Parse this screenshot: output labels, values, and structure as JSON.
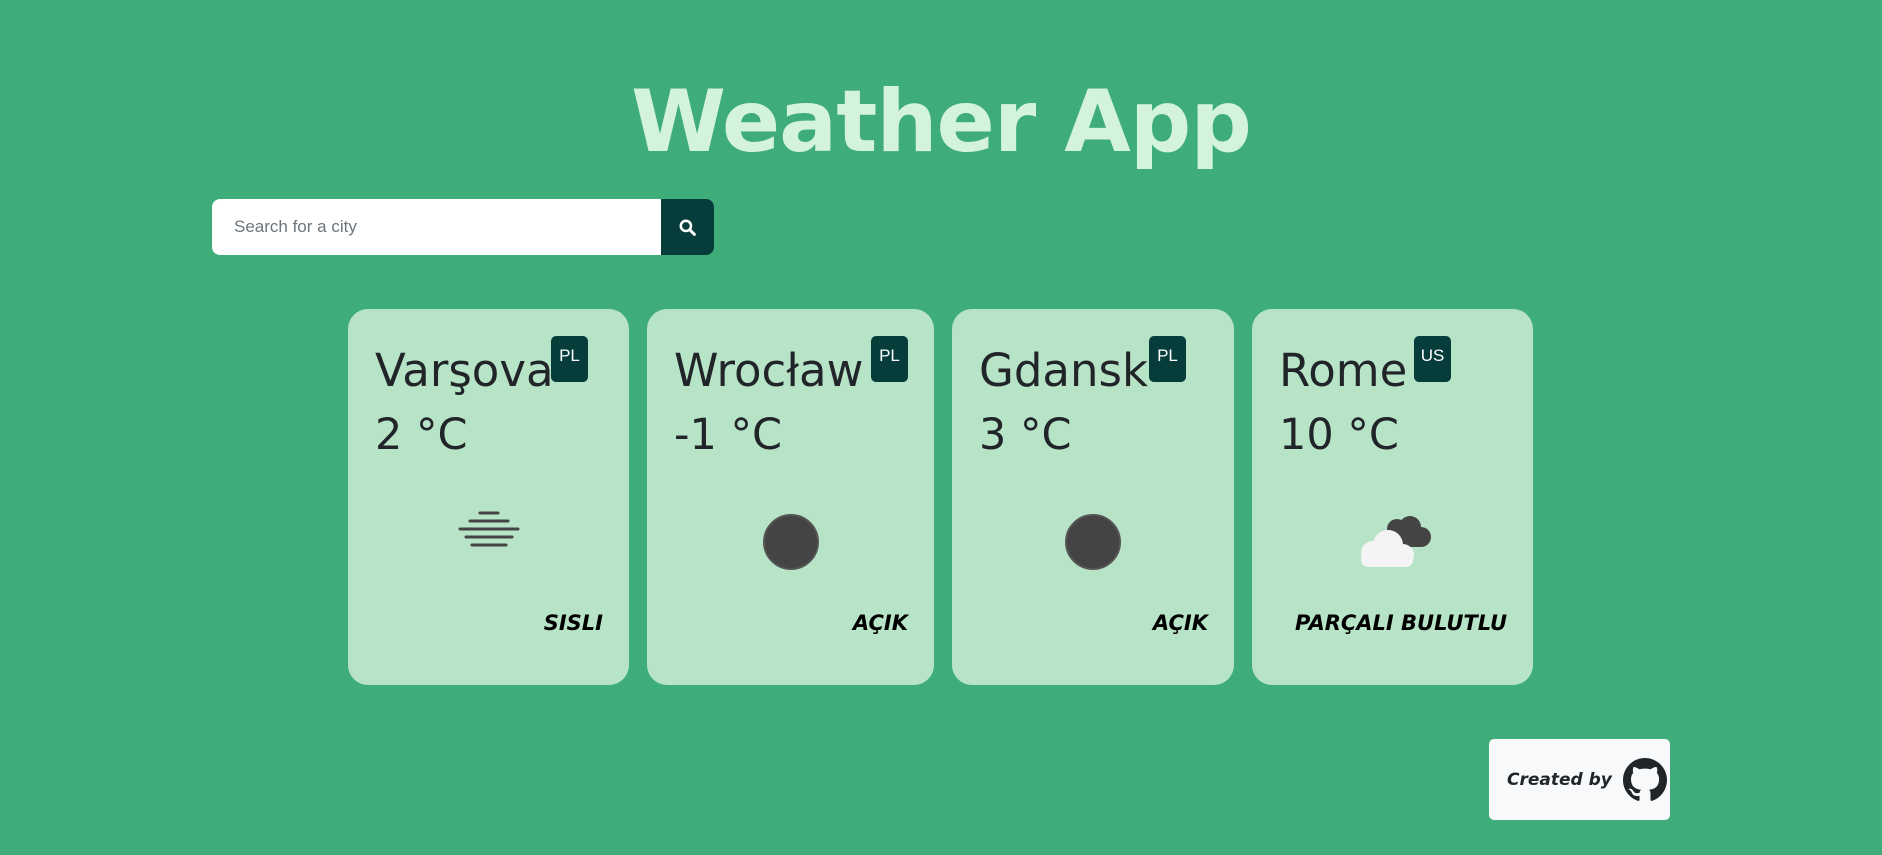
{
  "header": {
    "title": "Weather App"
  },
  "search": {
    "placeholder": "Search for a city",
    "value": "",
    "button_icon": "search-icon"
  },
  "cards": [
    {
      "city": "Varşova",
      "country": "PL",
      "temperature": "2 °C",
      "icon": "fog-icon",
      "description": "SISLI"
    },
    {
      "city": "Wrocław",
      "country": "PL",
      "temperature": "-1 °C",
      "icon": "clear-icon",
      "description": "AÇIK"
    },
    {
      "city": "Gdansk",
      "country": "PL",
      "temperature": "3 °C",
      "icon": "clear-icon",
      "description": "AÇIK"
    },
    {
      "city": "Rome",
      "country": "US",
      "temperature": "10 °C",
      "icon": "partly-cloudy-icon",
      "description": "PARÇALI BULUTLU"
    }
  ],
  "footer": {
    "credit_text": "Created by",
    "credit_icon": "github-icon"
  },
  "colors": {
    "background": "#3ead79",
    "title": "#d4f3dc",
    "card": "#b7e4c7",
    "accent": "#063d3b",
    "credit_bg": "#f8f9fa"
  }
}
